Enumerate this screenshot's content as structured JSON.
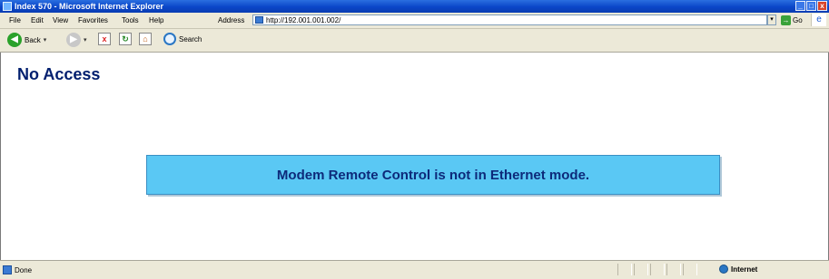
{
  "window": {
    "title": "Index 570 - Microsoft Internet Explorer",
    "controls": {
      "minimize": "_",
      "maximize": "□",
      "close": "x"
    }
  },
  "menu": {
    "items": [
      "File",
      "Edit",
      "View",
      "Favorites",
      "Tools",
      "Help"
    ]
  },
  "address": {
    "label": "Address",
    "url": "http://192.001.001.002/",
    "go_label": "Go",
    "dropdown_glyph": "▾"
  },
  "toolbar": {
    "back_label": "Back",
    "search_label": "Search",
    "dropdown_glyph": "▾",
    "back_glyph": "◀",
    "forward_glyph": "▶",
    "stop_glyph": "x",
    "refresh_glyph": "↻",
    "home_glyph": "⌂",
    "go_glyph": "→",
    "throbber_glyph": "e"
  },
  "page": {
    "heading": "No Access",
    "message": "Modem Remote Control is not in Ethernet mode.",
    "message_bg": "#5ac8f4",
    "heading_color": "#001e6e"
  },
  "status": {
    "text": "Done",
    "zone": "Internet"
  },
  "icons": [
    "ie-app-icon",
    "minimize-icon",
    "maximize-icon",
    "close-icon",
    "page-icon",
    "go-arrow-icon",
    "ie-logo-icon",
    "back-arrow-icon",
    "forward-arrow-icon",
    "stop-icon",
    "refresh-icon",
    "home-icon",
    "search-icon",
    "globe-icon"
  ]
}
